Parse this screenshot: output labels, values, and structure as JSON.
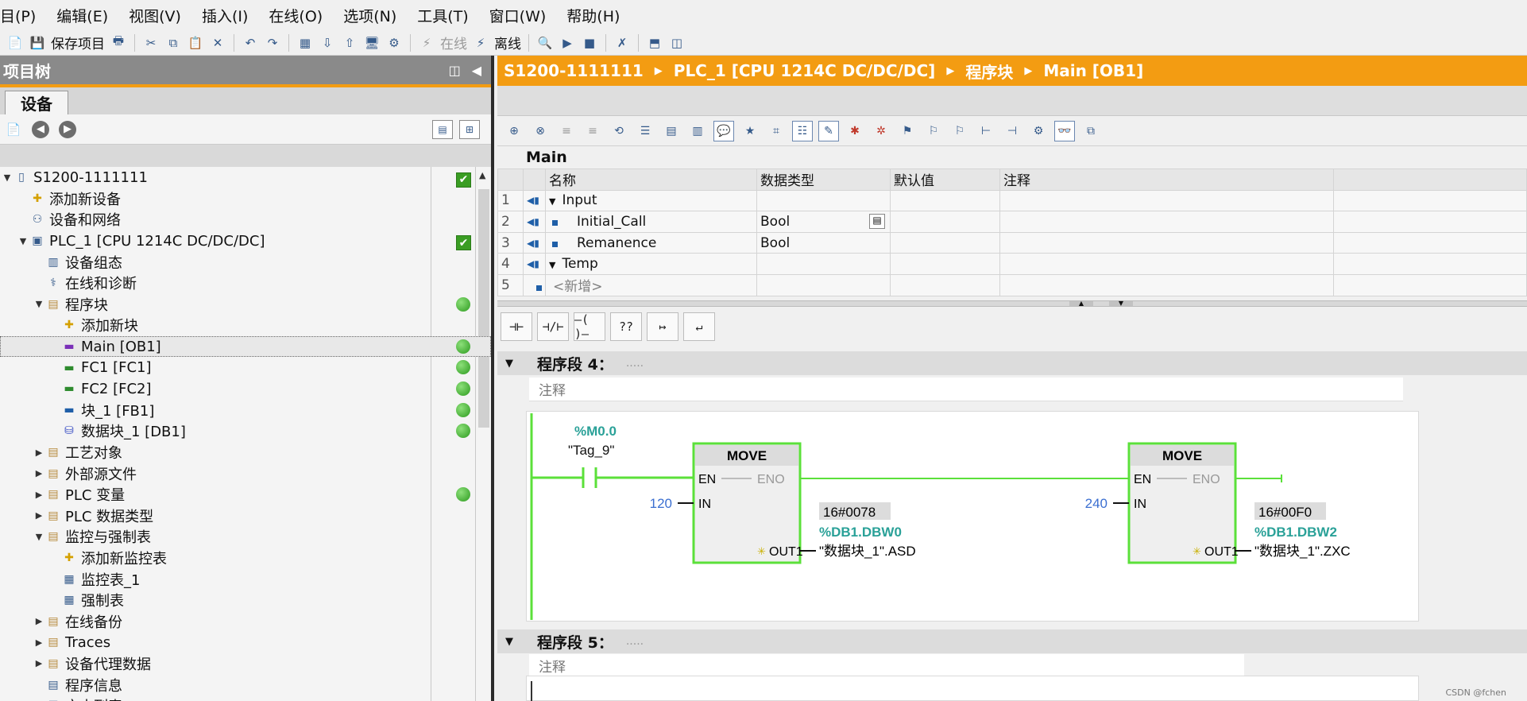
{
  "menu": [
    "目(P)",
    "编辑(E)",
    "视图(V)",
    "插入(I)",
    "在线(O)",
    "选项(N)",
    "工具(T)",
    "窗口(W)",
    "帮助(H)"
  ],
  "toolbar": {
    "save_label": "保存项目",
    "online_label": "在线",
    "offline_label": "离线"
  },
  "left_panel": {
    "title": "项目树",
    "tab": "设备",
    "tree": [
      {
        "label": "S1200-1111111",
        "level": 0,
        "arrow": "▼",
        "icon": "page-icon",
        "status": "check"
      },
      {
        "label": "添加新设备",
        "level": 1,
        "arrow": "",
        "icon": "add-device-icon",
        "status": ""
      },
      {
        "label": "设备和网络",
        "level": 1,
        "arrow": "",
        "icon": "network-icon",
        "status": ""
      },
      {
        "label": "PLC_1 [CPU 1214C DC/DC/DC]",
        "level": 1,
        "arrow": "▼",
        "icon": "plc-icon",
        "status": "check"
      },
      {
        "label": "设备组态",
        "level": 2,
        "arrow": "",
        "icon": "device-config-icon",
        "status": ""
      },
      {
        "label": "在线和诊断",
        "level": 2,
        "arrow": "",
        "icon": "diagnostics-icon",
        "status": ""
      },
      {
        "label": "程序块",
        "level": 2,
        "arrow": "▼",
        "icon": "folder-icon",
        "status": "dot"
      },
      {
        "label": "添加新块",
        "level": 3,
        "arrow": "",
        "icon": "add-block-icon",
        "status": ""
      },
      {
        "label": "Main [OB1]",
        "level": 3,
        "arrow": "",
        "icon": "ob-icon",
        "status": "dot",
        "selected": true
      },
      {
        "label": "FC1 [FC1]",
        "level": 3,
        "arrow": "",
        "icon": "fc-icon",
        "status": "dot"
      },
      {
        "label": "FC2 [FC2]",
        "level": 3,
        "arrow": "",
        "icon": "fc-icon",
        "status": "dot"
      },
      {
        "label": "块_1 [FB1]",
        "level": 3,
        "arrow": "",
        "icon": "fb-icon",
        "status": "dot"
      },
      {
        "label": "数据块_1 [DB1]",
        "level": 3,
        "arrow": "",
        "icon": "db-icon",
        "status": "dot"
      },
      {
        "label": "工艺对象",
        "level": 2,
        "arrow": "▶",
        "icon": "folder-icon",
        "status": ""
      },
      {
        "label": "外部源文件",
        "level": 2,
        "arrow": "▶",
        "icon": "folder-icon",
        "status": ""
      },
      {
        "label": "PLC 变量",
        "level": 2,
        "arrow": "▶",
        "icon": "folder-icon",
        "status": "dot"
      },
      {
        "label": "PLC 数据类型",
        "level": 2,
        "arrow": "▶",
        "icon": "folder-icon",
        "status": ""
      },
      {
        "label": "监控与强制表",
        "level": 2,
        "arrow": "▼",
        "icon": "folder-icon",
        "status": ""
      },
      {
        "label": "添加新监控表",
        "level": 3,
        "arrow": "",
        "icon": "add-table-icon",
        "status": ""
      },
      {
        "label": "监控表_1",
        "level": 3,
        "arrow": "",
        "icon": "watch-table-icon",
        "status": ""
      },
      {
        "label": "强制表",
        "level": 3,
        "arrow": "",
        "icon": "force-table-icon",
        "status": ""
      },
      {
        "label": "在线备份",
        "level": 2,
        "arrow": "▶",
        "icon": "folder-icon",
        "status": ""
      },
      {
        "label": "Traces",
        "level": 2,
        "arrow": "▶",
        "icon": "folder-icon",
        "status": ""
      },
      {
        "label": "设备代理数据",
        "level": 2,
        "arrow": "▶",
        "icon": "folder-icon",
        "status": ""
      },
      {
        "label": "程序信息",
        "level": 2,
        "arrow": "",
        "icon": "info-icon",
        "status": ""
      },
      {
        "label": "文本列表",
        "level": 2,
        "arrow": "",
        "icon": "list-icon",
        "status": ""
      }
    ]
  },
  "breadcrumb": [
    "S1200-1111111",
    "PLC_1 [CPU 1214C DC/DC/DC]",
    "程序块",
    "Main [OB1]"
  ],
  "interface": {
    "title": "Main",
    "columns": [
      "名称",
      "数据类型",
      "默认值",
      "注释"
    ],
    "rows": [
      {
        "n": "1",
        "name": "Input",
        "type": "",
        "section": true
      },
      {
        "n": "2",
        "name": "Initial_Call",
        "type": "Bool",
        "section": false
      },
      {
        "n": "3",
        "name": "Remanence",
        "type": "Bool",
        "section": false
      },
      {
        "n": "4",
        "name": "Temp",
        "type": "",
        "section": true
      },
      {
        "n": "5",
        "name": "<新增>",
        "type": "",
        "section": false,
        "placeholder": true
      }
    ]
  },
  "ladder_tools": [
    "⊣⊢",
    "⊣/⊢",
    "–( )–",
    "??",
    "↦",
    "↵"
  ],
  "networks": [
    {
      "title": "程序段 4：",
      "dots": ".....",
      "comment": "注释",
      "contact": {
        "address": "%M0.0",
        "tag": "\"Tag_9\""
      },
      "blocks": [
        {
          "name": "MOVE",
          "en": "EN",
          "eno": "ENO",
          "in_label": "IN",
          "out_label": "OUT1",
          "in_value": "120",
          "monitor": "16#0078",
          "out_address": "%DB1.DBW0",
          "out_tag": "\"数据块_1\".ASD"
        },
        {
          "name": "MOVE",
          "en": "EN",
          "eno": "ENO",
          "in_label": "IN",
          "out_label": "OUT1",
          "in_value": "240",
          "monitor": "16#00F0",
          "out_address": "%DB1.DBW2",
          "out_tag": "\"数据块_1\".ZXC"
        }
      ]
    },
    {
      "title": "程序段 5：",
      "dots": ".....",
      "comment": "注释"
    }
  ],
  "watermark": "CSDN @fchen",
  "colors": {
    "accent": "#f39c12",
    "energized": "#5be03a",
    "address": "#2aa198",
    "block_border": "#5be03a"
  }
}
